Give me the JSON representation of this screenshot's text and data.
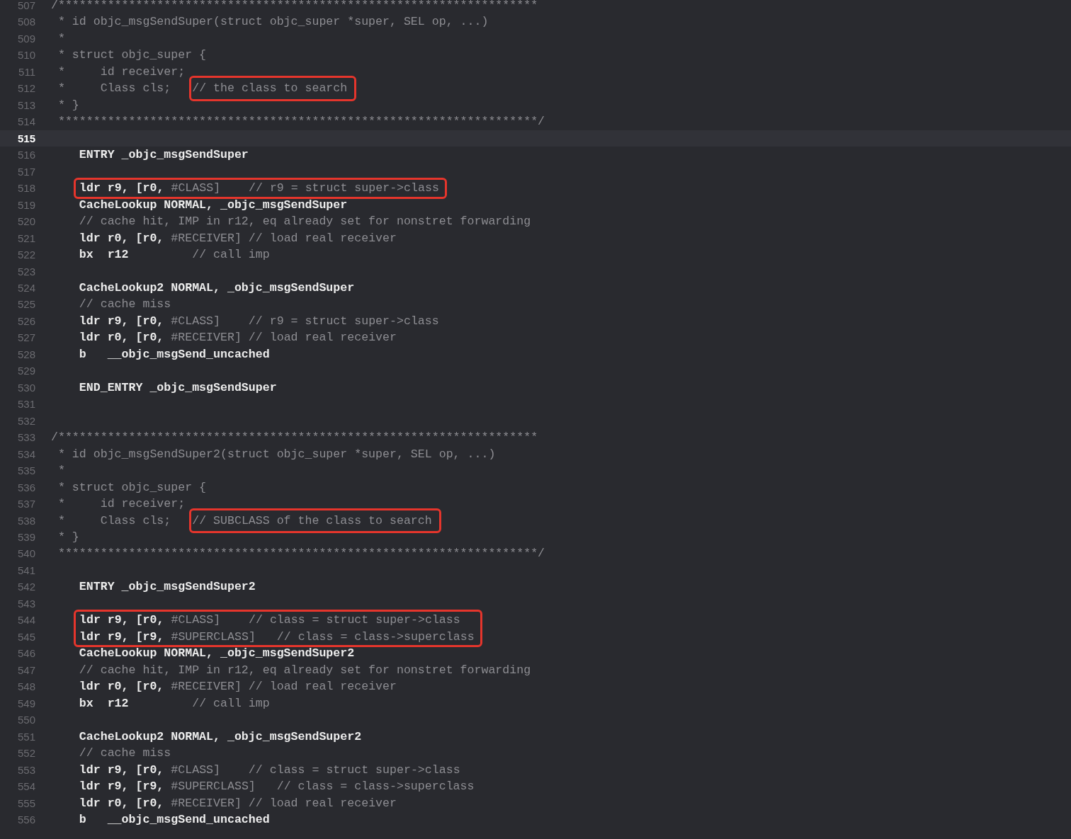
{
  "editor": {
    "lines": [
      {
        "number": "507",
        "current": false,
        "segments": [
          {
            "kind": "comment",
            "text": "/********************************************************************"
          }
        ]
      },
      {
        "number": "508",
        "current": false,
        "segments": [
          {
            "kind": "comment",
            "text": " * id objc_msgSendSuper(struct objc_super *super, SEL op, ...)"
          }
        ]
      },
      {
        "number": "509",
        "current": false,
        "segments": [
          {
            "kind": "comment",
            "text": " *"
          }
        ]
      },
      {
        "number": "510",
        "current": false,
        "segments": [
          {
            "kind": "comment",
            "text": " * struct objc_super {"
          }
        ]
      },
      {
        "number": "511",
        "current": false,
        "segments": [
          {
            "kind": "comment",
            "text": " *     id receiver;"
          }
        ]
      },
      {
        "number": "512",
        "current": false,
        "segments": [
          {
            "kind": "comment",
            "text": " *     Class cls;   "
          },
          {
            "kind": "annotation",
            "segments": [
              {
                "kind": "comment",
                "text": "// the class to search"
              }
            ]
          }
        ]
      },
      {
        "number": "513",
        "current": false,
        "segments": [
          {
            "kind": "comment",
            "text": " * }"
          }
        ]
      },
      {
        "number": "514",
        "current": false,
        "segments": [
          {
            "kind": "comment",
            "text": " ********************************************************************/"
          }
        ]
      },
      {
        "number": "515",
        "current": true
      },
      {
        "number": "516",
        "current": false,
        "segments": [
          {
            "kind": "code",
            "text": "    ENTRY _objc_msgSendSuper"
          }
        ]
      },
      {
        "number": "517",
        "current": false
      },
      {
        "kind": "boxed_group",
        "lines": [
          {
            "number": "518",
            "current": false,
            "segments": [
              {
                "kind": "code",
                "text": "ldr r9, [r0, "
              },
              {
                "kind": "const",
                "text": "#CLASS]"
              },
              {
                "kind": "comment",
                "text": "    // r9 = struct super->class"
              }
            ]
          }
        ]
      },
      {
        "number": "519",
        "current": false,
        "segments": [
          {
            "kind": "code",
            "text": "    CacheLookup NORMAL, _objc_msgSendSuper"
          }
        ]
      },
      {
        "number": "520",
        "current": false,
        "segments": [
          {
            "kind": "comment",
            "text": "    // cache hit, IMP in r12, eq already set for nonstret forwarding"
          }
        ]
      },
      {
        "number": "521",
        "current": false,
        "segments": [
          {
            "kind": "code",
            "text": "    ldr r0, [r0, "
          },
          {
            "kind": "const",
            "text": "#RECEIVER]"
          },
          {
            "kind": "comment",
            "text": " // load real receiver"
          }
        ]
      },
      {
        "number": "522",
        "current": false,
        "segments": [
          {
            "kind": "code",
            "text": "    bx  r12"
          },
          {
            "kind": "comment",
            "text": "         // call imp"
          }
        ]
      },
      {
        "number": "523",
        "current": false
      },
      {
        "number": "524",
        "current": false,
        "segments": [
          {
            "kind": "code",
            "text": "    CacheLookup2 NORMAL, _objc_msgSendSuper"
          }
        ]
      },
      {
        "number": "525",
        "current": false,
        "segments": [
          {
            "kind": "comment",
            "text": "    // cache miss"
          }
        ]
      },
      {
        "number": "526",
        "current": false,
        "segments": [
          {
            "kind": "code",
            "text": "    ldr r9, [r0, "
          },
          {
            "kind": "const",
            "text": "#CLASS]"
          },
          {
            "kind": "comment",
            "text": "    // r9 = struct super->class"
          }
        ]
      },
      {
        "number": "527",
        "current": false,
        "segments": [
          {
            "kind": "code",
            "text": "    ldr r0, [r0, "
          },
          {
            "kind": "const",
            "text": "#RECEIVER]"
          },
          {
            "kind": "comment",
            "text": " // load real receiver"
          }
        ]
      },
      {
        "number": "528",
        "current": false,
        "segments": [
          {
            "kind": "code",
            "text": "    b   __objc_msgSend_uncached"
          }
        ]
      },
      {
        "number": "529",
        "current": false
      },
      {
        "number": "530",
        "current": false,
        "segments": [
          {
            "kind": "code",
            "text": "    END_ENTRY _objc_msgSendSuper"
          }
        ]
      },
      {
        "number": "531",
        "current": false
      },
      {
        "number": "532",
        "current": false
      },
      {
        "number": "533",
        "current": false,
        "segments": [
          {
            "kind": "comment",
            "text": "/********************************************************************"
          }
        ]
      },
      {
        "number": "534",
        "current": false,
        "segments": [
          {
            "kind": "comment",
            "text": " * id objc_msgSendSuper2(struct objc_super *super, SEL op, ...)"
          }
        ]
      },
      {
        "number": "535",
        "current": false,
        "segments": [
          {
            "kind": "comment",
            "text": " *"
          }
        ]
      },
      {
        "number": "536",
        "current": false,
        "segments": [
          {
            "kind": "comment",
            "text": " * struct objc_super {"
          }
        ]
      },
      {
        "number": "537",
        "current": false,
        "segments": [
          {
            "kind": "comment",
            "text": " *     id receiver;"
          }
        ]
      },
      {
        "number": "538",
        "current": false,
        "segments": [
          {
            "kind": "comment",
            "text": " *     Class cls;   "
          },
          {
            "kind": "annotation",
            "segments": [
              {
                "kind": "comment",
                "text": "// SUBCLASS of the class to search"
              }
            ]
          }
        ]
      },
      {
        "number": "539",
        "current": false,
        "segments": [
          {
            "kind": "comment",
            "text": " * }"
          }
        ]
      },
      {
        "number": "540",
        "current": false,
        "segments": [
          {
            "kind": "comment",
            "text": " ********************************************************************/"
          }
        ]
      },
      {
        "number": "541",
        "current": false
      },
      {
        "number": "542",
        "current": false,
        "segments": [
          {
            "kind": "code",
            "text": "    ENTRY _objc_msgSendSuper2"
          }
        ]
      },
      {
        "number": "543",
        "current": false
      },
      {
        "kind": "boxed_group",
        "lines": [
          {
            "number": "544",
            "current": false,
            "segments": [
              {
                "kind": "code",
                "text": "ldr r9, [r0, "
              },
              {
                "kind": "const",
                "text": "#CLASS]"
              },
              {
                "kind": "comment",
                "text": "    // class = struct super->class"
              }
            ]
          },
          {
            "number": "545",
            "current": false,
            "segments": [
              {
                "kind": "code",
                "text": "ldr r9, [r9, "
              },
              {
                "kind": "const",
                "text": "#SUPERCLASS]"
              },
              {
                "kind": "comment",
                "text": "   // class = class->superclass"
              }
            ]
          }
        ]
      },
      {
        "number": "546",
        "current": false,
        "segments": [
          {
            "kind": "code",
            "text": "    CacheLookup NORMAL, _objc_msgSendSuper2"
          }
        ]
      },
      {
        "number": "547",
        "current": false,
        "segments": [
          {
            "kind": "comment",
            "text": "    // cache hit, IMP in r12, eq already set for nonstret forwarding"
          }
        ]
      },
      {
        "number": "548",
        "current": false,
        "segments": [
          {
            "kind": "code",
            "text": "    ldr r0, [r0, "
          },
          {
            "kind": "const",
            "text": "#RECEIVER]"
          },
          {
            "kind": "comment",
            "text": " // load real receiver"
          }
        ]
      },
      {
        "number": "549",
        "current": false,
        "segments": [
          {
            "kind": "code",
            "text": "    bx  r12"
          },
          {
            "kind": "comment",
            "text": "         // call imp"
          }
        ]
      },
      {
        "number": "550",
        "current": false
      },
      {
        "number": "551",
        "current": false,
        "segments": [
          {
            "kind": "code",
            "text": "    CacheLookup2 NORMAL, _objc_msgSendSuper2"
          }
        ]
      },
      {
        "number": "552",
        "current": false,
        "segments": [
          {
            "kind": "comment",
            "text": "    // cache miss"
          }
        ]
      },
      {
        "number": "553",
        "current": false,
        "segments": [
          {
            "kind": "code",
            "text": "    ldr r9, [r0, "
          },
          {
            "kind": "const",
            "text": "#CLASS]"
          },
          {
            "kind": "comment",
            "text": "    // class = struct super->class"
          }
        ]
      },
      {
        "number": "554",
        "current": false,
        "segments": [
          {
            "kind": "code",
            "text": "    ldr r9, [r9, "
          },
          {
            "kind": "const",
            "text": "#SUPERCLASS]"
          },
          {
            "kind": "comment",
            "text": "   // class = class->superclass"
          }
        ]
      },
      {
        "number": "555",
        "current": false,
        "segments": [
          {
            "kind": "code",
            "text": "    ldr r0, [r0, "
          },
          {
            "kind": "const",
            "text": "#RECEIVER]"
          },
          {
            "kind": "comment",
            "text": " // load real receiver"
          }
        ]
      },
      {
        "number": "556",
        "current": false,
        "segments": [
          {
            "kind": "code",
            "text": "    b   __objc_msgSend_uncached"
          }
        ]
      }
    ]
  }
}
